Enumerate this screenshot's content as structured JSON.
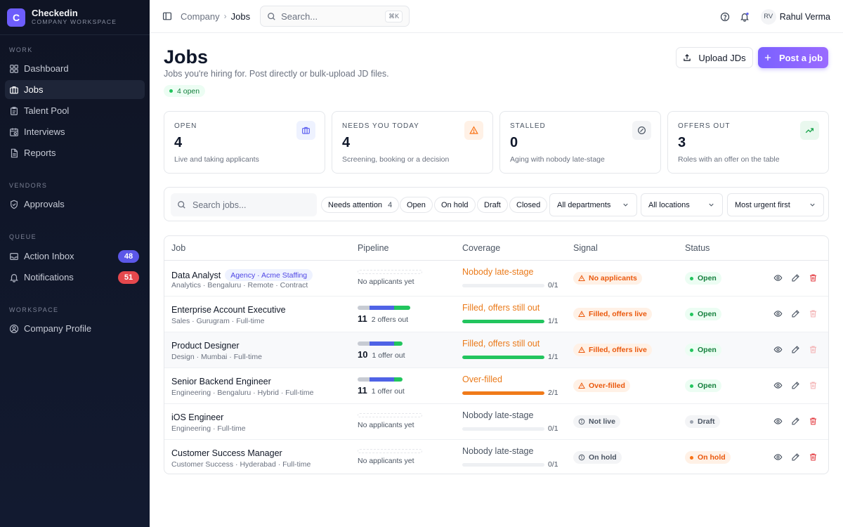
{
  "brand": {
    "logo_letter": "C",
    "name": "Checkedin",
    "subtitle": "COMPANY WORKSPACE"
  },
  "sidebar": {
    "sections": [
      {
        "title": "WORK",
        "items": [
          {
            "label": "Dashboard",
            "icon": "dashboard-icon"
          },
          {
            "label": "Jobs",
            "icon": "briefcase-icon",
            "active": true
          },
          {
            "label": "Talent Pool",
            "icon": "clipboard-icon"
          },
          {
            "label": "Interviews",
            "icon": "calendar-icon"
          },
          {
            "label": "Reports",
            "icon": "report-icon"
          }
        ]
      },
      {
        "title": "VENDORS",
        "items": [
          {
            "label": "Approvals",
            "icon": "shield-check-icon"
          }
        ]
      },
      {
        "title": "QUEUE",
        "items": [
          {
            "label": "Action Inbox",
            "icon": "inbox-icon",
            "badge": "48",
            "badge_color": "#5b57e8"
          },
          {
            "label": "Notifications",
            "icon": "bell-icon",
            "badge": "51",
            "badge_color": "#e5484d"
          }
        ]
      },
      {
        "title": "WORKSPACE",
        "items": [
          {
            "label": "Company Profile",
            "icon": "user-circle-icon"
          }
        ]
      }
    ]
  },
  "topbar": {
    "breadcrumb": [
      "Company",
      "Jobs"
    ],
    "search_placeholder": "Search...",
    "search_shortcut": "⌘K",
    "user_initials": "RV",
    "user_name": "Rahul Verma"
  },
  "header": {
    "title": "Jobs",
    "subtitle": "Jobs you're hiring for. Post directly or bulk-upload JD files.",
    "open_pill": "4 open",
    "upload_label": "Upload JDs",
    "post_label": "Post a job"
  },
  "stats": [
    {
      "label": "OPEN",
      "value": "4",
      "desc": "Live and taking applicants",
      "icon": "briefcase-icon",
      "icon_color": "#6366f1",
      "icon_bg": "#eef2ff"
    },
    {
      "label": "NEEDS YOU TODAY",
      "value": "4",
      "desc": "Screening, booking or a decision",
      "icon": "warning-icon",
      "icon_color": "#f97316",
      "icon_bg": "#fff1e6"
    },
    {
      "label": "STALLED",
      "value": "0",
      "desc": "Aging with nobody late-stage",
      "icon": "no-sign-icon",
      "icon_color": "#4b5563",
      "icon_bg": "#f3f4f6"
    },
    {
      "label": "OFFERS OUT",
      "value": "3",
      "desc": "Roles with an offer on the table",
      "icon": "trend-up-icon",
      "icon_color": "#16a34a",
      "icon_bg": "#e9f8ee"
    }
  ],
  "filters": {
    "search_placeholder": "Search jobs...",
    "chips": [
      {
        "label": "Needs attention",
        "count": "4"
      },
      {
        "label": "Open"
      },
      {
        "label": "On hold"
      },
      {
        "label": "Draft"
      },
      {
        "label": "Closed"
      }
    ],
    "department": "All departments",
    "location": "All locations",
    "sort": "Most urgent first"
  },
  "table": {
    "columns": [
      "Job",
      "Pipeline",
      "Coverage",
      "Signal",
      "Status"
    ],
    "rows": [
      {
        "title": "Data Analyst",
        "agency": "Agency · Acme Staffing",
        "meta": "Analytics · Bengaluru · Remote · Contract",
        "pipeline_count": "",
        "pipeline_text": "No applicants yet",
        "pipeline_segments": [],
        "coverage_label": "Nobody late-stage",
        "coverage_color": "#ea7a1a",
        "coverage_fill": 0,
        "coverage_fill_color": "#22c55e",
        "coverage_ratio": "0/1",
        "signal": "No applicants",
        "signal_type": "warn",
        "status": "Open",
        "status_type": "open",
        "delete_active": true
      },
      {
        "title": "Enterprise Account Executive",
        "agency": "",
        "meta": "Sales · Gurugram · Full-time",
        "pipeline_count": "11",
        "pipeline_text": "2 offers out",
        "pipeline_segments": [
          3,
          6,
          4
        ],
        "coverage_label": "Filled, offers still out",
        "coverage_color": "#ea7a1a",
        "coverage_fill": 1,
        "coverage_fill_color": "#22c55e",
        "coverage_ratio": "1/1",
        "signal": "Filled, offers live",
        "signal_type": "warn",
        "status": "Open",
        "status_type": "open",
        "delete_active": false
      },
      {
        "title": "Product Designer",
        "agency": "",
        "meta": "Design · Mumbai · Full-time",
        "pipeline_count": "10",
        "pipeline_text": "1 offer out",
        "pipeline_segments": [
          3,
          6,
          2
        ],
        "coverage_label": "Filled, offers still out",
        "coverage_color": "#ea7a1a",
        "coverage_fill": 1,
        "coverage_fill_color": "#22c55e",
        "coverage_ratio": "1/1",
        "signal": "Filled, offers live",
        "signal_type": "warn",
        "status": "Open",
        "status_type": "open",
        "delete_active": false,
        "highlight": true
      },
      {
        "title": "Senior Backend Engineer",
        "agency": "",
        "meta": "Engineering · Bengaluru · Hybrid · Full-time",
        "pipeline_count": "11",
        "pipeline_text": "1 offer out",
        "pipeline_segments": [
          3,
          6,
          2
        ],
        "coverage_label": "Over-filled",
        "coverage_color": "#ea7a1a",
        "coverage_fill": 1,
        "coverage_fill_color": "#f07a1a",
        "coverage_ratio": "2/1",
        "signal": "Over-filled",
        "signal_type": "warn",
        "status": "Open",
        "status_type": "open",
        "delete_active": false
      },
      {
        "title": "iOS Engineer",
        "agency": "",
        "meta": "Engineering · Full-time",
        "pipeline_count": "",
        "pipeline_text": "No applicants yet",
        "pipeline_segments": [],
        "coverage_label": "Nobody late-stage",
        "coverage_color": "#4b5563",
        "coverage_fill": 0,
        "coverage_fill_color": "#22c55e",
        "coverage_ratio": "0/1",
        "signal": "Not live",
        "signal_type": "neutral",
        "status": "Draft",
        "status_type": "draft",
        "delete_active": true
      },
      {
        "title": "Customer Success Manager",
        "agency": "",
        "meta": "Customer Success · Hyderabad · Full-time",
        "pipeline_count": "",
        "pipeline_text": "No applicants yet",
        "pipeline_segments": [],
        "coverage_label": "Nobody late-stage",
        "coverage_color": "#4b5563",
        "coverage_fill": 0,
        "coverage_fill_color": "#22c55e",
        "coverage_ratio": "0/1",
        "signal": "On hold",
        "signal_type": "neutral",
        "status": "On hold",
        "status_type": "hold",
        "delete_active": true
      }
    ]
  },
  "colors": {
    "accent": "#7b61ff",
    "pipeline": [
      "#c7cbd3",
      "#4f63e6",
      "#22c55e"
    ],
    "status_open": "#16a34a",
    "status_hold": "#ea580c",
    "danger": "#e5484d"
  }
}
